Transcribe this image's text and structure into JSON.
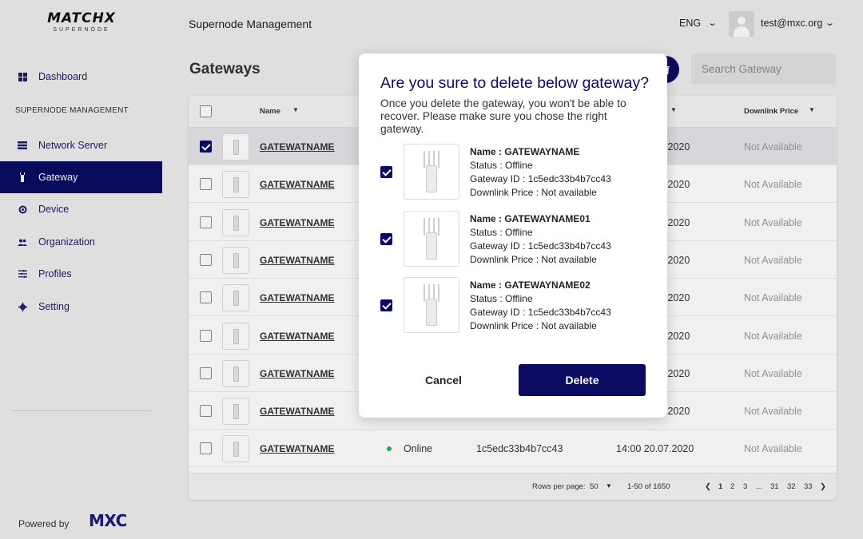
{
  "brand": {
    "logo_text": "MATCHX",
    "logo_sub": "SUPERNODE",
    "powered_by": "Powered by",
    "powered_logo": "MXC"
  },
  "sidebar": {
    "section_label": "SUPERNODE MANAGEMENT",
    "items": [
      {
        "label": "Dashboard",
        "icon": "grid-icon"
      },
      {
        "label": "Network Server",
        "icon": "server-icon"
      },
      {
        "label": "Gateway",
        "icon": "gateway-icon"
      },
      {
        "label": "Device",
        "icon": "device-icon"
      },
      {
        "label": "Organization",
        "icon": "people-icon"
      },
      {
        "label": "Profiles",
        "icon": "sliders-icon"
      },
      {
        "label": "Setting",
        "icon": "gear-icon"
      }
    ]
  },
  "header": {
    "title": "Supernode Management",
    "language": "ENG",
    "user_email": "test@mxc.org"
  },
  "page": {
    "title": "Gateways",
    "search_placeholder": "Search Gateway"
  },
  "table": {
    "columns": {
      "name": "Name",
      "downlink_price": "Downlink Price"
    },
    "partial_date": ".2020",
    "rows": [
      {
        "name": "GATEWATNAME",
        "checked": true,
        "downlink": "Not Available"
      },
      {
        "name": "GATEWATNAME",
        "checked": false,
        "downlink": "Not Available"
      },
      {
        "name": "GATEWATNAME",
        "checked": false,
        "downlink": "Not Available"
      },
      {
        "name": "GATEWATNAME",
        "checked": false,
        "downlink": "Not Available"
      },
      {
        "name": "GATEWATNAME",
        "checked": false,
        "downlink": "Not Available"
      },
      {
        "name": "GATEWATNAME",
        "checked": false,
        "downlink": "Not Available"
      },
      {
        "name": "GATEWATNAME",
        "checked": false,
        "downlink": "Not Available"
      },
      {
        "name": "GATEWATNAME",
        "checked": false,
        "downlink": "Not Available"
      },
      {
        "name": "GATEWATNAME",
        "checked": false,
        "status": "Online",
        "gateway_id": "1c5edc33b4b7cc43",
        "last_seen": "14:00 20.07.2020",
        "downlink": "Not Available"
      }
    ],
    "footer": {
      "rows_per_page_label": "Rows per page:",
      "rows_per_page_value": "50",
      "range": "1-50 of 1650",
      "pages": [
        "1",
        "2",
        "3",
        "...",
        "31",
        "32",
        "33"
      ],
      "current_page": "1"
    }
  },
  "modal": {
    "title": "Are you sure to delete below gateway?",
    "message": "Once you delete the gateway, you won't be able to recover. Please make sure you chose the right gateway.",
    "items": [
      {
        "name": "Name : GATEWAYNAME",
        "status": "Status : Offline",
        "gateway_id": "Gateway ID : 1c5edc33b4b7cc43",
        "downlink": "Downlink Price : Not available"
      },
      {
        "name": "Name : GATEWAYNAME01",
        "status": "Status : Offline",
        "gateway_id": "Gateway ID : 1c5edc33b4b7cc43",
        "downlink": "Downlink Price : Not available"
      },
      {
        "name": "Name : GATEWAYNAME02",
        "status": "Status : Offline",
        "gateway_id": "Gateway ID : 1c5edc33b4b7cc43",
        "downlink": "Downlink Price : Not available"
      }
    ],
    "cancel_label": "Cancel",
    "delete_label": "Delete"
  },
  "colors": {
    "primary": "#0b0b62",
    "online": "#2bb34c",
    "background": "#ededed"
  }
}
